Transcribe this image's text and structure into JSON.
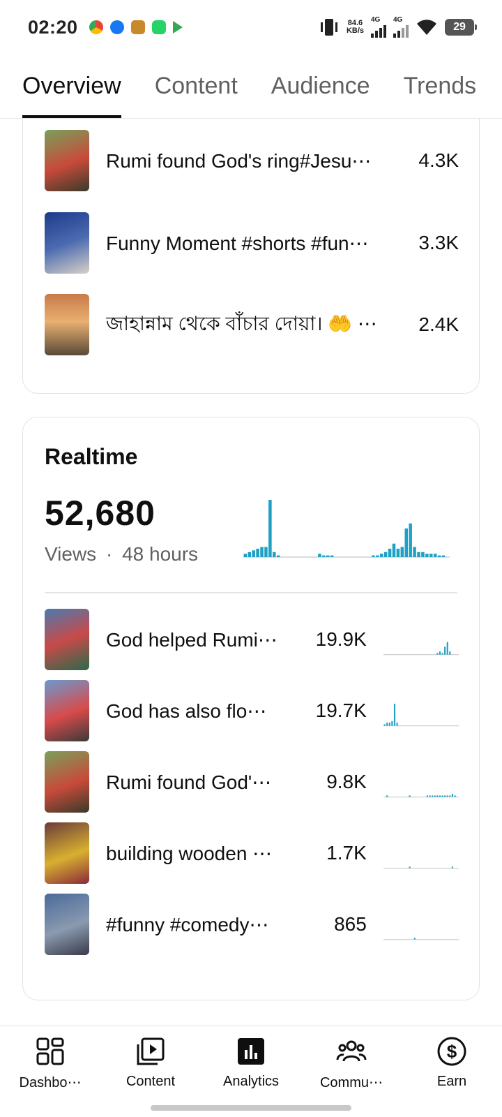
{
  "status_bar": {
    "time": "02:20",
    "net_speed_value": "84.6",
    "net_speed_unit": "KB/s",
    "net_type_1": "4G",
    "net_type_2": "4G",
    "battery": "29"
  },
  "tabs": [
    {
      "label": "Overview",
      "active": true
    },
    {
      "label": "Content",
      "active": false
    },
    {
      "label": "Audience",
      "active": false
    },
    {
      "label": "Trends",
      "active": false
    }
  ],
  "top_content": {
    "items": [
      {
        "title": "Rumi found God's ring#Jesu⋯",
        "value": "4.3K",
        "thumb_color": "#6a8a4a"
      },
      {
        "title": "Funny Moment #shorts #fun⋯",
        "value": "3.3K",
        "thumb_color": "#2b3a6b"
      },
      {
        "title": "জাহান্নাম থেকে বাঁচার দোয়া। 🤲 ⋯",
        "value": "2.4K",
        "thumb_color": "#8a6a4a"
      }
    ]
  },
  "realtime": {
    "title": "Realtime",
    "views": "52,680",
    "views_label": "Views",
    "separator": "·",
    "period": "48 hours",
    "accent_color": "#1ea1c5",
    "chart_data": {
      "type": "bar",
      "values": [
        2,
        3,
        4,
        5,
        6,
        6,
        34,
        3,
        1,
        0,
        0,
        0,
        0,
        0,
        0,
        0,
        0,
        0,
        2,
        1,
        1,
        1,
        0,
        0,
        0,
        0,
        0,
        0,
        0,
        0,
        0,
        1,
        1,
        2,
        3,
        5,
        8,
        5,
        6,
        17,
        20,
        6,
        3,
        3,
        2,
        2,
        2,
        1,
        1,
        0
      ]
    },
    "items": [
      {
        "title": "God helped Rumi⋯",
        "value": "19.9K",
        "thumb_color": "#3d6fa8",
        "spark": [
          0,
          0,
          0,
          0,
          0,
          0,
          0,
          0,
          0,
          0,
          0,
          0,
          0,
          0,
          0,
          0,
          0,
          0,
          0,
          0,
          0,
          1,
          2,
          1,
          5,
          8,
          2,
          0,
          0,
          0
        ]
      },
      {
        "title": "God has also flo⋯",
        "value": "19.7K",
        "thumb_color": "#4a7ab0",
        "spark": [
          1,
          2,
          2,
          3,
          14,
          2,
          0,
          0,
          0,
          0,
          0,
          0,
          0,
          0,
          0,
          0,
          0,
          0,
          0,
          0,
          0,
          0,
          0,
          0,
          0,
          0,
          0,
          0,
          0,
          0
        ]
      },
      {
        "title": "Rumi found God'⋯",
        "value": "9.8K",
        "thumb_color": "#6a8a4a",
        "spark": [
          0,
          1,
          0,
          0,
          0,
          0,
          0,
          0,
          0,
          0,
          1,
          0,
          0,
          0,
          0,
          0,
          0,
          1,
          1,
          1,
          1,
          1,
          1,
          1,
          1,
          1,
          1,
          2,
          1,
          0
        ]
      },
      {
        "title": "building wooden ⋯",
        "value": "1.7K",
        "thumb_color": "#8a3a4a",
        "spark": [
          0,
          0,
          0,
          0,
          0,
          0,
          0,
          0,
          0,
          0,
          1,
          0,
          0,
          0,
          0,
          0,
          0,
          0,
          0,
          0,
          0,
          0,
          0,
          0,
          0,
          0,
          0,
          1,
          0,
          0
        ]
      },
      {
        "title": "#funny #comedy⋯",
        "value": "865",
        "thumb_color": "#3a4a6a",
        "spark": [
          0,
          0,
          0,
          0,
          0,
          0,
          0,
          0,
          0,
          0,
          0,
          0,
          1,
          0,
          0,
          0,
          0,
          0,
          0,
          0,
          0,
          0,
          0,
          0,
          0,
          0,
          0,
          0,
          0,
          0
        ]
      }
    ]
  },
  "bottom_nav": [
    {
      "label": "Dashbo⋯",
      "icon": "dashboard-icon"
    },
    {
      "label": "Content",
      "icon": "content-icon"
    },
    {
      "label": "Analytics",
      "icon": "analytics-icon"
    },
    {
      "label": "Commu⋯",
      "icon": "community-icon"
    },
    {
      "label": "Earn",
      "icon": "earn-icon"
    }
  ]
}
